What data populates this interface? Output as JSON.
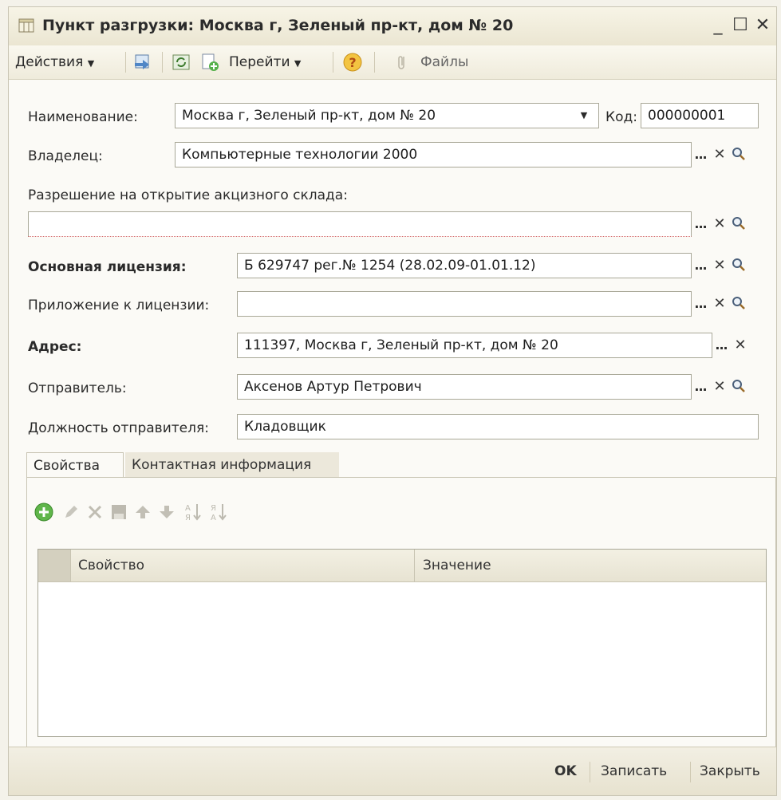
{
  "window": {
    "title": "Пункт разгрузки: Москва г, Зеленый пр-кт, дом № 20",
    "controls": {
      "minimize": "_",
      "maximize": "☐",
      "close": "✕"
    }
  },
  "toolbar": {
    "actions_label": "Действия",
    "goto_label": "Перейти",
    "files_label": "Файлы",
    "icons": [
      "save-close-icon",
      "refresh-icon",
      "copy-new-icon",
      "help-icon",
      "paperclip-icon"
    ]
  },
  "form": {
    "name_label": "Наименование:",
    "name_value": "Москва г, Зеленый пр-кт, дом № 20",
    "code_label": "Код:",
    "code_value": "000000001",
    "owner_label": "Владелец:",
    "owner_value": "Компьютерные технологии 2000",
    "permit_label": "Разрешение на открытие акцизного склада:",
    "permit_value": "",
    "license_label": "Основная лицензия:",
    "license_value": "Б 629747 рег.№ 1254 (28.02.09-01.01.12)",
    "appendix_label": "Приложение к лицензии:",
    "appendix_value": "",
    "address_label": "Адрес:",
    "address_value": "111397, Москва г, Зеленый пр-кт, дом № 20",
    "sender_label": "Отправитель:",
    "sender_value": "Аксенов Артур Петрович",
    "sender_position_label": "Должность отправителя:",
    "sender_position_value": "Кладовщик"
  },
  "buttons": {
    "select": "...",
    "clear": "✕",
    "open": "🔍"
  },
  "tabs": [
    {
      "label": "Свойства",
      "active": true
    },
    {
      "label": "Контактная информация",
      "active": false
    }
  ],
  "properties_grid": {
    "columns": [
      "Свойство",
      "Значение"
    ],
    "rows": []
  },
  "footer": {
    "ok_label": "OK",
    "save_label": "Записать",
    "close_label": "Закрыть"
  },
  "colors": {
    "accent": "#cfa54a",
    "green": "#4caa3a",
    "window_bg": "#fbfaf6"
  }
}
